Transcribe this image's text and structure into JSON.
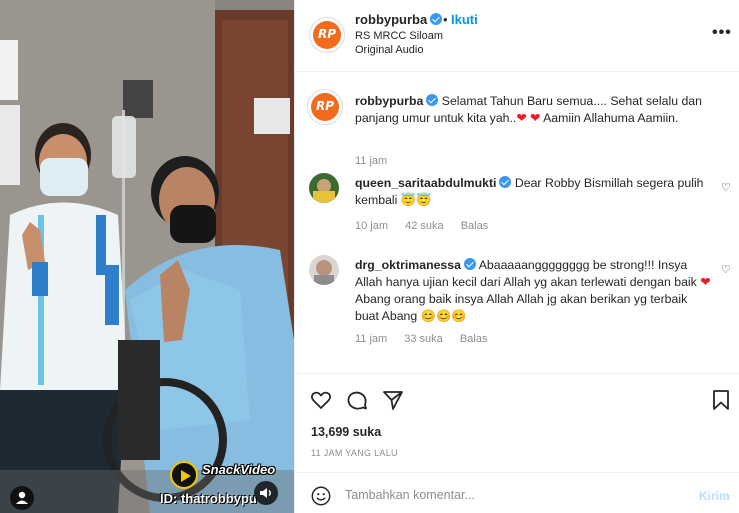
{
  "header": {
    "username": "robbypurba",
    "follow_label": "Ikuti",
    "separator": "•",
    "location": "RS MRCC Siloam",
    "audio": "Original Audio",
    "avatar_text": "RP",
    "more_icon": "more-horizontal-icon"
  },
  "media": {
    "watermark_brand": "SnackVideo",
    "watermark_id": "ID: thatrobbypu"
  },
  "caption": {
    "username": "robbypurba",
    "text_1": "Selamat Tahun Baru semua.... Sehat selalu dan panjang umur untuk kita yah..",
    "text_2": "Aamiin Allahuma Aamiin.",
    "hearts": "❤ ❤",
    "time": "11 jam"
  },
  "comments": [
    {
      "username": "queen_saritaabdulmukti",
      "text": "Dear Robby Bismillah segera pulih kembali",
      "emojis": "😇😇",
      "time": "10 jam",
      "likes": "42 suka",
      "reply": "Balas"
    },
    {
      "username": "drg_oktrimanessa",
      "text_1": "Abaaaaangggggggg be strong!!! Insya Allah hanya ujian kecil dari Allah yg akan terlewati dengan baik",
      "heart": "❤",
      "text_2": "Abang orang baik insya Allah Allah jg akan berikan yg terbaik buat Abang",
      "emojis": "😊😊😊",
      "time": "11 jam",
      "likes": "33 suka",
      "reply": "Balas"
    }
  ],
  "stats": {
    "likes": "13,699 suka",
    "posted": "11 JAM YANG LALU"
  },
  "composer": {
    "placeholder": "Tambahkan komentar...",
    "post_label": "Kirim"
  },
  "colors": {
    "link_blue": "#0095f6",
    "post_disabled": "#b2dffc",
    "heart_red": "#ed1c24",
    "brand_orange": "#f26a1b"
  }
}
